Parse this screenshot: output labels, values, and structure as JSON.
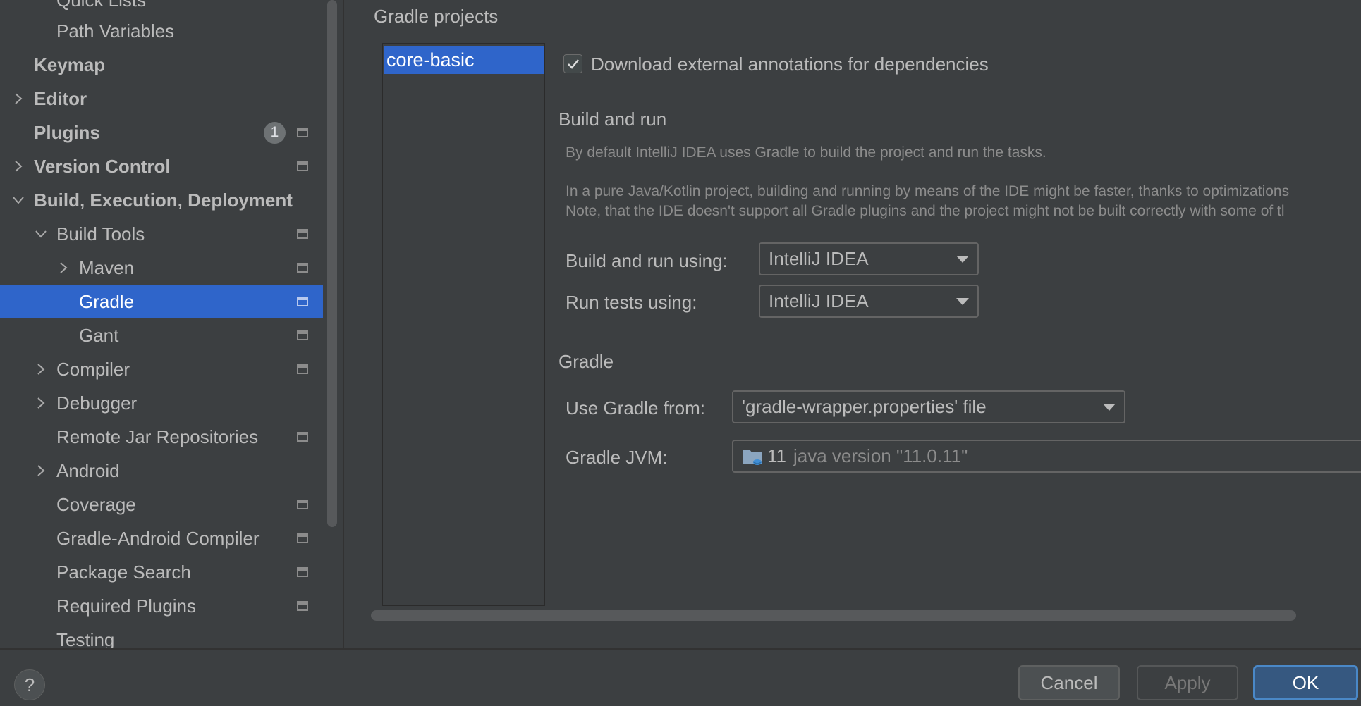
{
  "sidebar": {
    "items": [
      {
        "label": "Quick Lists"
      },
      {
        "label": "Path Variables"
      },
      {
        "label": "Keymap"
      },
      {
        "label": "Editor"
      },
      {
        "label": "Plugins",
        "badge": "1"
      },
      {
        "label": "Version Control"
      },
      {
        "label": "Build, Execution, Deployment"
      },
      {
        "label": "Build Tools"
      },
      {
        "label": "Maven"
      },
      {
        "label": "Gradle"
      },
      {
        "label": "Gant"
      },
      {
        "label": "Compiler"
      },
      {
        "label": "Debugger"
      },
      {
        "label": "Remote Jar Repositories"
      },
      {
        "label": "Android"
      },
      {
        "label": "Coverage"
      },
      {
        "label": "Gradle-Android Compiler"
      },
      {
        "label": "Package Search"
      },
      {
        "label": "Required Plugins"
      },
      {
        "label": "Testing"
      }
    ]
  },
  "main": {
    "projects_title": "Gradle projects",
    "project_item": "core-basic",
    "download_annotations_label": "Download external annotations for dependencies",
    "download_annotations_checked": true,
    "build_run_title": "Build and run",
    "build_run_desc1": "By default IntelliJ IDEA uses Gradle to build the project and run the tasks.",
    "build_run_desc2": "In a pure Java/Kotlin project, building and running by means of the IDE might be faster, thanks to optimizations",
    "build_run_desc3": "Note, that the IDE doesn't support all Gradle plugins and the project might not be built correctly with some of tl",
    "build_run_using_label": "Build and run using:",
    "build_run_using_value": "IntelliJ IDEA",
    "run_tests_label": "Run tests using:",
    "run_tests_value": "IntelliJ IDEA",
    "gradle_title": "Gradle",
    "use_gradle_from_label": "Use Gradle from:",
    "use_gradle_from_value": "'gradle-wrapper.properties' file",
    "gradle_jvm_label": "Gradle JVM:",
    "gradle_jvm_version": "11",
    "gradle_jvm_detail": "java version \"11.0.11\""
  },
  "footer": {
    "help": "?",
    "cancel": "Cancel",
    "apply": "Apply",
    "ok": "OK"
  },
  "colors": {
    "selection": "#2f65ca",
    "background": "#3c3f41",
    "primary_button": "#365880"
  }
}
